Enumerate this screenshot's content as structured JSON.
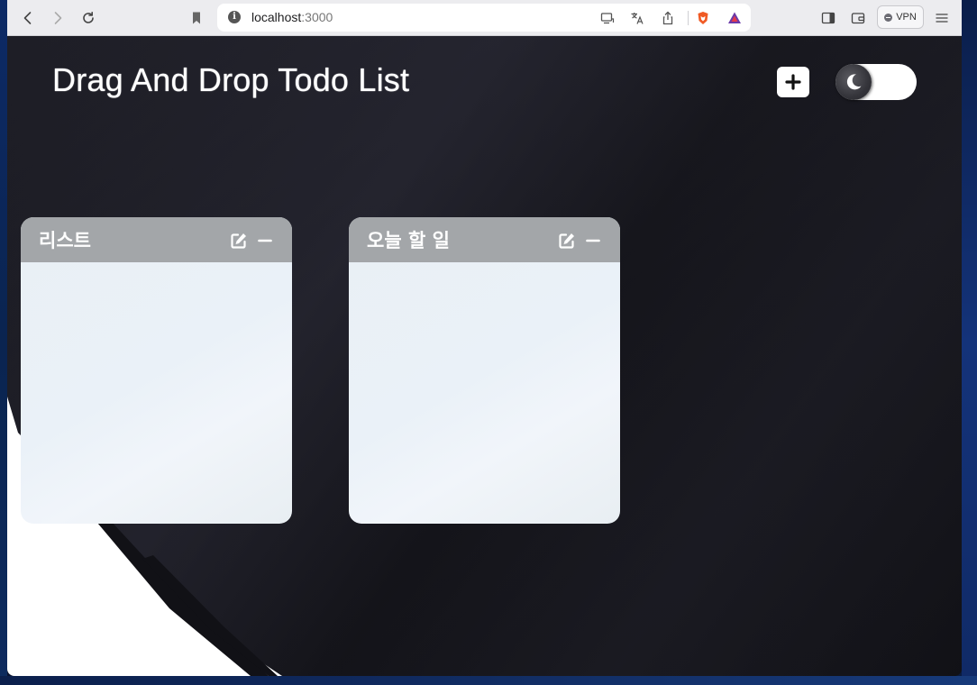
{
  "browser": {
    "url_host": "localhost",
    "url_port": ":3000",
    "vpn_label": "VPN",
    "icons": [
      "back-icon",
      "forward-icon",
      "reload-icon",
      "bookmark-icon",
      "site-info-icon",
      "cast-icon",
      "translate-icon",
      "share-icon",
      "brave-shields-icon",
      "brave-rewards-icon",
      "sidebar-icon",
      "wallet-icon",
      "menu-icon"
    ]
  },
  "header": {
    "title": "Drag And Drop Todo List",
    "add_icon": "plus-icon",
    "theme_icon": "moon-icon"
  },
  "columns": [
    {
      "title": "리스트",
      "items": []
    },
    {
      "title": "오늘 할 일",
      "items": []
    }
  ],
  "colors": {
    "column_header": "#a3a6a9",
    "column_body": "#eaf1f6",
    "page_background": "#16161c",
    "title_text": "#ffffff"
  }
}
